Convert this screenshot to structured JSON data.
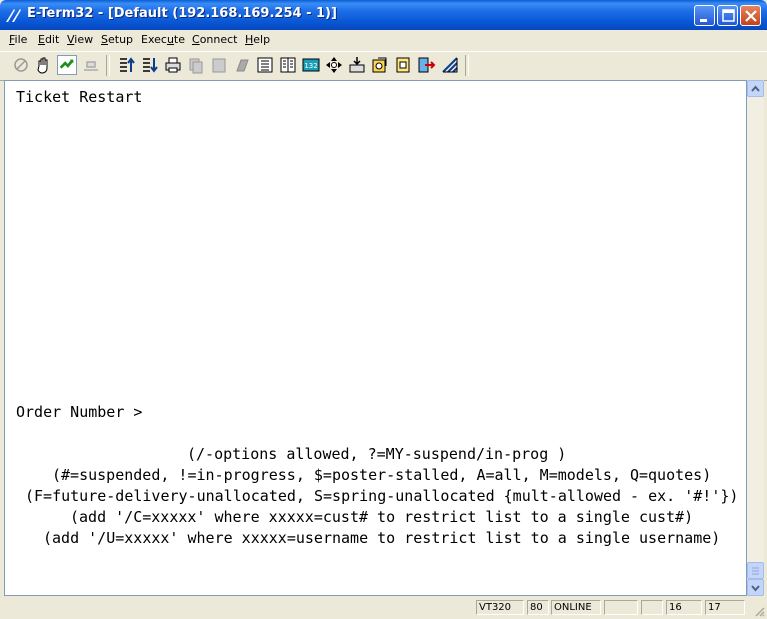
{
  "window": {
    "title": "E-Term32 - [Default (192.168.169.254 - 1)]",
    "icon": "eterm-app-icon"
  },
  "menubar": {
    "items": [
      {
        "accel": "F",
        "rest": "ile"
      },
      {
        "accel": "E",
        "rest": "dit"
      },
      {
        "accel": "V",
        "rest": "iew"
      },
      {
        "accel": "S",
        "rest": "etup"
      },
      {
        "pre": "Exec",
        "accel": "u",
        "rest": "te"
      },
      {
        "accel": "C",
        "rest": "onnect"
      },
      {
        "accel": "H",
        "rest": "elp"
      }
    ]
  },
  "toolbar": {
    "buttons": [
      "stop-icon",
      "hand-icon",
      "connect-icon",
      "disconnect-icon",
      "upload-icon",
      "download-icon",
      "print-icon",
      "copy-icon",
      "paste-icon",
      "clear-icon",
      "page-icon",
      "columns-icon",
      "132-columns-icon",
      "move-icon",
      "tray-icon",
      "capture-icon",
      "log-icon",
      "exit-icon",
      "resize-icon"
    ]
  },
  "terminal": {
    "lines": [
      "Ticket Restart",
      "Order Number >",
      "(/-options allowed, ?=MY-suspend/in-prog )",
      "(#=suspended, !=in-progress, $=poster-stalled, A=all, M=models, Q=quotes)",
      "(F=future-delivery-unallocated, S=spring-unallocated {mult-allowed - ex. '#!'})",
      "(add '/C=xxxxx' where xxxxx=cust# to restrict list to a single cust#)",
      "(add '/U=xxxxx' where xxxxx=username to restrict list to a single username)"
    ]
  },
  "statusbar": {
    "emulation": "VT320",
    "columns": "80",
    "state": "ONLINE",
    "blank1": "",
    "blank2": "",
    "row": "16",
    "col": "17"
  },
  "colors": {
    "titlebar": "#0a58d6",
    "close_button": "#c2421a",
    "terminal_bg": "#ffffff",
    "chrome": "#ece9d8"
  }
}
